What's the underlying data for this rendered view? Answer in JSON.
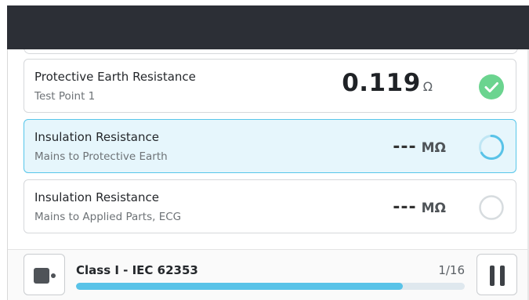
{
  "tests": [
    {
      "title": "Protective Earth Resistance",
      "subtitle": "Test Point 1",
      "value": "0.119",
      "unit": "Ω",
      "status": "passed",
      "status_color": "#6bd48f"
    },
    {
      "title": "Insulation Resistance",
      "subtitle": "Mains to Protective Earth",
      "value": "---",
      "unit": "MΩ",
      "status": "in-progress",
      "status_color": "#59c3e8"
    },
    {
      "title": "Insulation Resistance",
      "subtitle": "Mains to Applied Parts, ECG",
      "value": "---",
      "unit": "MΩ",
      "status": "pending",
      "status_color": "#d7dcdf"
    }
  ],
  "footer": {
    "sequence_label": "Class I - IEC 62353",
    "progress_text": "1/16",
    "progress_fraction": 0.84,
    "stop_icon": "stop-icon",
    "pause_icon": "pause-icon"
  },
  "colors": {
    "accent": "#59c3e8",
    "active_card_bg": "#e6f6fc",
    "top_bar": "#2c2f36"
  }
}
